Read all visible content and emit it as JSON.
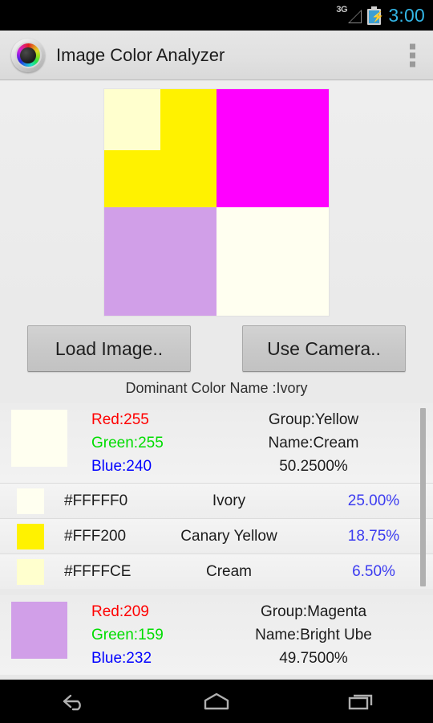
{
  "statusbar": {
    "network_label": "3G",
    "time": "3:00",
    "battery_icon": "battery-charging-icon",
    "signal_icon": "signal-icon"
  },
  "actionbar": {
    "app_icon": "color-wheel-icon",
    "title": "Image Color Analyzer",
    "overflow_icon": "overflow-menu-icon"
  },
  "preview": {
    "name": "analyzed-image-preview",
    "quadrants": [
      {
        "name": "top-left-yellow",
        "color": "#FFF200"
      },
      {
        "name": "top-left-inner-cream",
        "color": "#FFFFCE"
      },
      {
        "name": "top-right-magenta",
        "color": "#FF00FF"
      },
      {
        "name": "bottom-left-ube",
        "color": "#D19FE8"
      },
      {
        "name": "bottom-right-ivory",
        "color": "#FFFFF0"
      }
    ]
  },
  "buttons": {
    "load_image": "Load Image..",
    "use_camera": "Use Camera.."
  },
  "dominant": "Dominant Color Name :Ivory",
  "groups": [
    {
      "swatch": "#FFFFF0",
      "red_label": "Red:255",
      "green_label": "Green:255",
      "blue_label": "Blue:240",
      "group_label": "Group:Yellow",
      "name_label": "Name:Cream",
      "percent_label": "50.2500%",
      "rows": [
        {
          "swatch": "#FFFFF0",
          "hex": "#FFFFF0",
          "name": "Ivory",
          "percent": "25.00%"
        },
        {
          "swatch": "#FFF200",
          "hex": "#FFF200",
          "name": "Canary Yellow",
          "percent": "18.75%"
        },
        {
          "swatch": "#FFFFCE",
          "hex": "#FFFFCE",
          "name": "Cream",
          "percent": "6.50%"
        }
      ]
    },
    {
      "swatch": "#D19FE8",
      "red_label": "Red:209",
      "green_label": "Green:159",
      "blue_label": "Blue:232",
      "group_label": "Group:Magenta",
      "name_label": "Name:Bright Ube",
      "percent_label": "49.7500%",
      "rows": []
    }
  ],
  "navbar": {
    "back": "back-icon",
    "home": "home-icon",
    "recents": "recents-icon"
  }
}
